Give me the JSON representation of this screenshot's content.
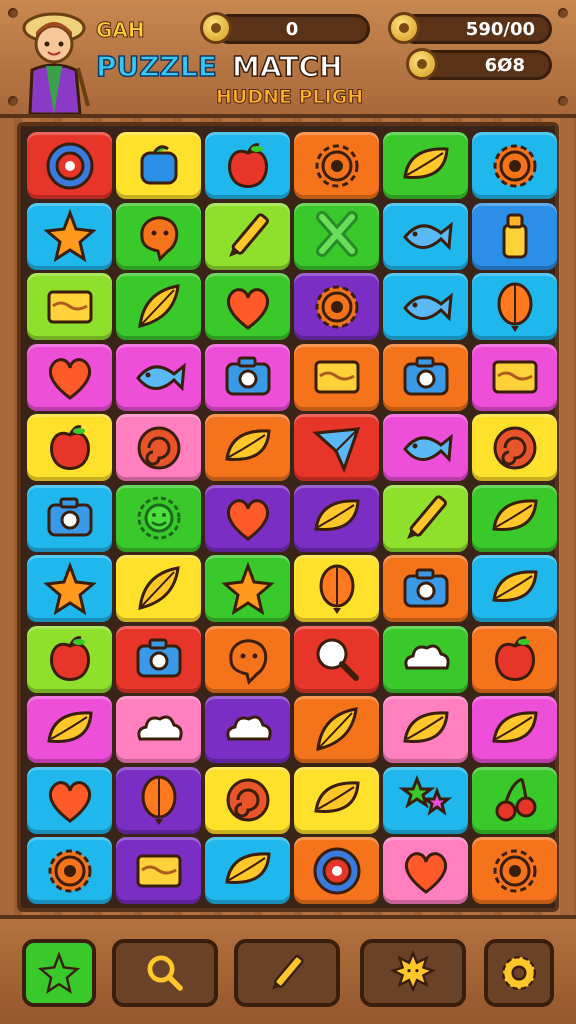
{
  "header": {
    "label_small": "GAH",
    "title_puzzle": "PUZZLE",
    "title_match": "MATCH",
    "subtitle": "HUDNE PLIGH",
    "score_top": "0",
    "coins_top": "590/00",
    "coins_bottom": "6Ø8"
  },
  "colors": {
    "red": "#e8352a",
    "yellow": "#ffe02a",
    "cyan": "#1fb7ec",
    "orange": "#f5741b",
    "green": "#39c92b",
    "lime": "#8fe02c",
    "magenta": "#ee4fd8",
    "purple": "#7a2ec4",
    "pink": "#ff7fbf",
    "blue": "#2b8fe8"
  },
  "board": {
    "rows": [
      [
        {
          "c": "red",
          "i": "target-icon"
        },
        {
          "c": "yellow",
          "i": "jar-icon"
        },
        {
          "c": "cyan",
          "i": "apple-icon"
        },
        {
          "c": "orange",
          "i": "gear-icon"
        },
        {
          "c": "green",
          "i": "leaf-icon"
        },
        {
          "c": "cyan",
          "i": "gear-icon"
        }
      ],
      [
        {
          "c": "cyan",
          "i": "star-icon"
        },
        {
          "c": "green",
          "i": "blob-icon"
        },
        {
          "c": "lime",
          "i": "pencil-icon"
        },
        {
          "c": "green",
          "i": "cross-icon"
        },
        {
          "c": "cyan",
          "i": "fish-icon"
        },
        {
          "c": "blue",
          "i": "bottle-icon"
        }
      ],
      [
        {
          "c": "lime",
          "i": "box-icon"
        },
        {
          "c": "green",
          "i": "feather-icon"
        },
        {
          "c": "green",
          "i": "heart-icon"
        },
        {
          "c": "purple",
          "i": "gear-icon"
        },
        {
          "c": "cyan",
          "i": "fish-icon"
        },
        {
          "c": "cyan",
          "i": "balloon-icon"
        }
      ],
      [
        {
          "c": "magenta",
          "i": "heart-icon"
        },
        {
          "c": "magenta",
          "i": "fish-icon"
        },
        {
          "c": "magenta",
          "i": "camera-icon"
        },
        {
          "c": "orange",
          "i": "box-icon"
        },
        {
          "c": "orange",
          "i": "camera-icon"
        },
        {
          "c": "magenta",
          "i": "box-icon"
        }
      ],
      [
        {
          "c": "yellow",
          "i": "apple-icon"
        },
        {
          "c": "pink",
          "i": "swirl-icon"
        },
        {
          "c": "orange",
          "i": "leaf-icon"
        },
        {
          "c": "red",
          "i": "plane-icon"
        },
        {
          "c": "magenta",
          "i": "fish-icon"
        },
        {
          "c": "yellow",
          "i": "swirl-icon"
        }
      ],
      [
        {
          "c": "cyan",
          "i": "camera-icon"
        },
        {
          "c": "green",
          "i": "face-icon"
        },
        {
          "c": "purple",
          "i": "heart-icon"
        },
        {
          "c": "purple",
          "i": "leaf-icon"
        },
        {
          "c": "lime",
          "i": "pencil-icon"
        },
        {
          "c": "green",
          "i": "leaf-icon"
        }
      ],
      [
        {
          "c": "cyan",
          "i": "star-icon"
        },
        {
          "c": "yellow",
          "i": "feather-icon"
        },
        {
          "c": "green",
          "i": "star-icon"
        },
        {
          "c": "yellow",
          "i": "balloon-icon"
        },
        {
          "c": "orange",
          "i": "camera-icon"
        },
        {
          "c": "cyan",
          "i": "leaf-icon"
        }
      ],
      [
        {
          "c": "lime",
          "i": "apple-icon"
        },
        {
          "c": "red",
          "i": "camera-icon"
        },
        {
          "c": "orange",
          "i": "blob-icon"
        },
        {
          "c": "red",
          "i": "search-icon"
        },
        {
          "c": "green",
          "i": "cloud-icon"
        },
        {
          "c": "orange",
          "i": "apple-icon"
        }
      ],
      [
        {
          "c": "magenta",
          "i": "leaf-icon"
        },
        {
          "c": "pink",
          "i": "cloud-icon"
        },
        {
          "c": "purple",
          "i": "cloud-icon"
        },
        {
          "c": "orange",
          "i": "feather-icon"
        },
        {
          "c": "pink",
          "i": "leaf-icon"
        },
        {
          "c": "magenta",
          "i": "leaf-icon"
        }
      ],
      [
        {
          "c": "cyan",
          "i": "heart-icon"
        },
        {
          "c": "purple",
          "i": "balloon-icon"
        },
        {
          "c": "yellow",
          "i": "swirl-icon"
        },
        {
          "c": "yellow",
          "i": "leaf-icon"
        },
        {
          "c": "cyan",
          "i": "flower-icon"
        },
        {
          "c": "green",
          "i": "cherry-icon"
        }
      ],
      [
        {
          "c": "cyan",
          "i": "gear-icon"
        },
        {
          "c": "purple",
          "i": "box-icon"
        },
        {
          "c": "cyan",
          "i": "leaf-icon"
        },
        {
          "c": "orange",
          "i": "target-icon"
        },
        {
          "c": "pink",
          "i": "heart-icon"
        },
        {
          "c": "orange",
          "i": "gear-icon"
        }
      ]
    ]
  },
  "toolbar": {
    "buttons": [
      {
        "name": "star-button",
        "icon": "star-icon",
        "bg": "#39c92b"
      },
      {
        "name": "search-button",
        "icon": "search-icon",
        "bg": "#6a4228"
      },
      {
        "name": "pencil-button",
        "icon": "pencil-icon",
        "bg": "#6a4228"
      },
      {
        "name": "sun-button",
        "icon": "sun-icon",
        "bg": "#6a4228"
      },
      {
        "name": "settings-button",
        "icon": "gear-icon",
        "bg": "#6a4228"
      }
    ]
  }
}
